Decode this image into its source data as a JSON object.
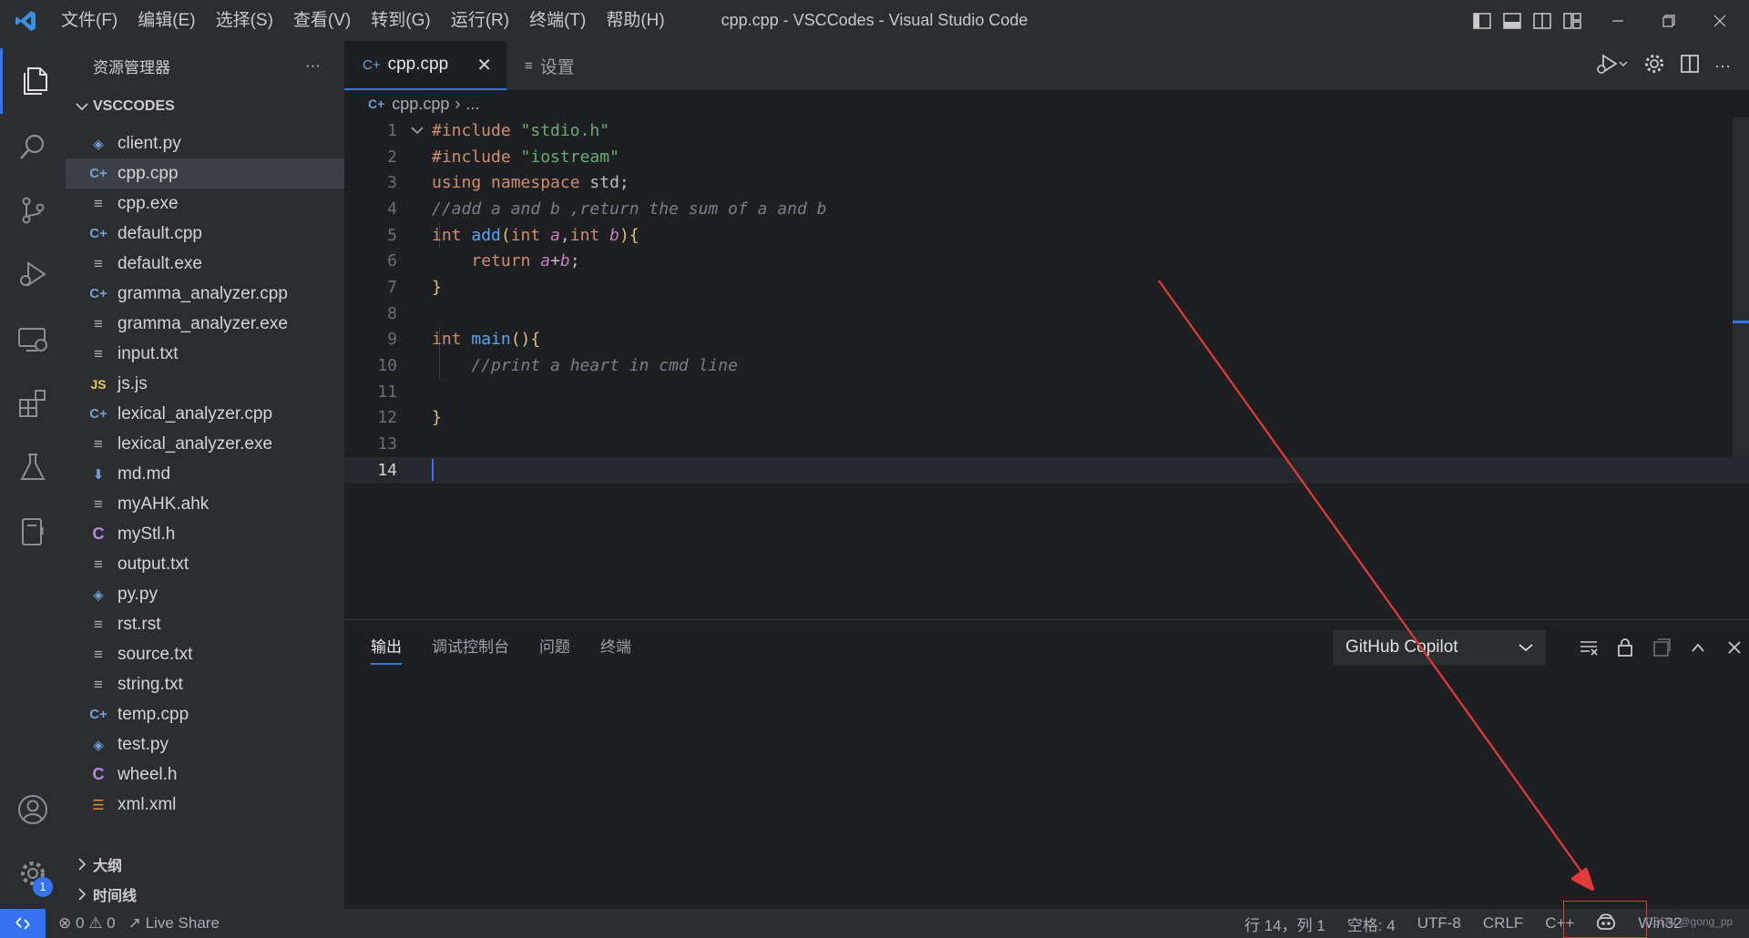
{
  "window": {
    "title": "cpp.cpp - VSCCodes - Visual Studio Code",
    "menu": [
      "文件(F)",
      "编辑(E)",
      "选择(S)",
      "查看(V)",
      "转到(G)",
      "运行(R)",
      "终端(T)",
      "帮助(H)"
    ]
  },
  "sidebar": {
    "title": "资源管理器",
    "more": "···",
    "folder": "VSCCODES",
    "files": [
      {
        "name": "client.py",
        "icon": "python-icon"
      },
      {
        "name": "cpp.cpp",
        "icon": "cpp-icon",
        "selected": true
      },
      {
        "name": "cpp.exe",
        "icon": "file-lines-icon"
      },
      {
        "name": "default.cpp",
        "icon": "cpp-icon"
      },
      {
        "name": "default.exe",
        "icon": "file-lines-icon"
      },
      {
        "name": "gramma_analyzer.cpp",
        "icon": "cpp-icon"
      },
      {
        "name": "gramma_analyzer.exe",
        "icon": "file-lines-icon"
      },
      {
        "name": "input.txt",
        "icon": "file-lines-icon"
      },
      {
        "name": "js.js",
        "icon": "js-icon"
      },
      {
        "name": "lexical_analyzer.cpp",
        "icon": "cpp-icon"
      },
      {
        "name": "lexical_analyzer.exe",
        "icon": "file-lines-icon"
      },
      {
        "name": "md.md",
        "icon": "markdown-icon"
      },
      {
        "name": "myAHK.ahk",
        "icon": "file-lines-icon"
      },
      {
        "name": "myStl.h",
        "icon": "c-header-icon"
      },
      {
        "name": "output.txt",
        "icon": "file-lines-icon"
      },
      {
        "name": "py.py",
        "icon": "python-icon"
      },
      {
        "name": "rst.rst",
        "icon": "file-lines-icon"
      },
      {
        "name": "source.txt",
        "icon": "file-lines-icon"
      },
      {
        "name": "string.txt",
        "icon": "file-lines-icon"
      },
      {
        "name": "temp.cpp",
        "icon": "cpp-icon"
      },
      {
        "name": "test.py",
        "icon": "python-icon"
      },
      {
        "name": "wheel.h",
        "icon": "c-header-icon"
      },
      {
        "name": "xml.xml",
        "icon": "rss-icon"
      }
    ],
    "outline": "大纲",
    "timeline": "时间线",
    "settings_badge": "1"
  },
  "editor": {
    "tabs": [
      {
        "label": "cpp.cpp",
        "active": true
      },
      {
        "label": "设置",
        "active": false
      }
    ],
    "breadcrumb": {
      "file": "cpp.cpp",
      "rest": "..."
    },
    "line_numbers": [
      "1",
      "2",
      "3",
      "4",
      "5",
      "6",
      "7",
      "8",
      "9",
      "10",
      "11",
      "12",
      "13",
      "14"
    ],
    "current_line": "14",
    "code_lines": [
      "#include \"stdio.h\"",
      "#include \"iostream\"",
      "using namespace std;",
      "//add a and b ,return the sum of a and b",
      "int add(int a,int b){",
      "    return a+b;",
      "}",
      "",
      "int main(){",
      "    //print a heart in cmd line",
      "",
      "}",
      "",
      ""
    ]
  },
  "panel": {
    "tabs": [
      "输出",
      "调试控制台",
      "问题",
      "终端"
    ],
    "active_tab": "输出",
    "channel": "GitHub Copilot"
  },
  "statusbar": {
    "errors": "0",
    "warnings": "0",
    "live_share": "Live Share",
    "position": "行 14，列 1",
    "spaces": "空格: 4",
    "encoding": "UTF-8",
    "eol": "CRLF",
    "language": "C++",
    "platform": "Win32",
    "watermark": "CSDN @gong_pp"
  },
  "colors": {
    "accent": "#3574f0",
    "annotation": "#e53a3a"
  }
}
